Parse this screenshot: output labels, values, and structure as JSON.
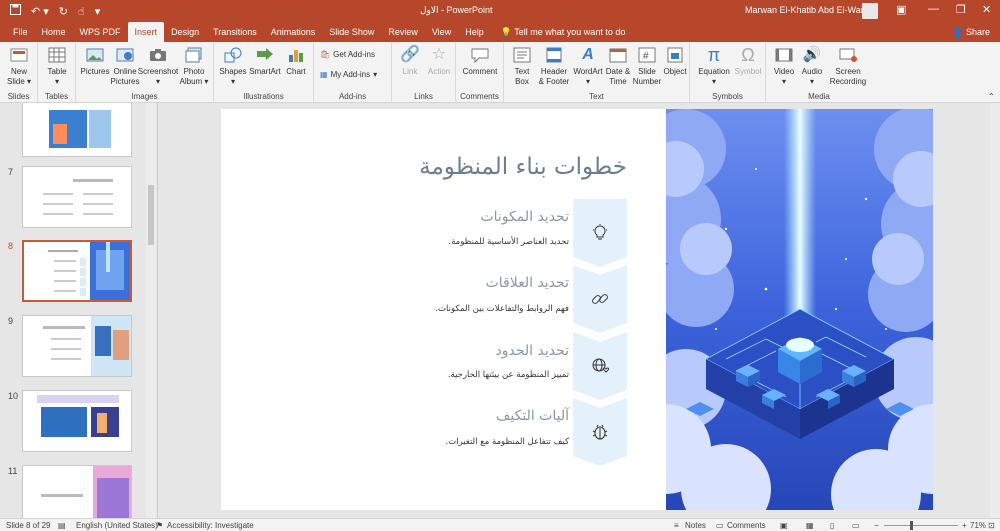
{
  "titlebar": {
    "title": "الاول  -  PowerPoint",
    "user": "Marwan El-Khatib Abd El-Wares",
    "colors": {
      "brand": "#b7472a"
    }
  },
  "menu": {
    "tabs": [
      "File",
      "Home",
      "WPS PDF",
      "Insert",
      "Design",
      "Transitions",
      "Animations",
      "Slide Show",
      "Review",
      "View",
      "Help"
    ],
    "active": "Insert",
    "tell_me": "Tell me what you want to do",
    "share": "Share"
  },
  "ribbon": {
    "groups": {
      "slides": "Slides",
      "tables": "Tables",
      "images": "Images",
      "illustrations": "Illustrations",
      "addins": "Add-ins",
      "links": "Links",
      "comments": "Comments",
      "text": "Text",
      "symbols": "Symbols",
      "media": "Media"
    },
    "buttons": {
      "new_slide": "New\nSlide ▾",
      "table": "Table\n▾",
      "pictures": "Pictures",
      "online_pictures": "Online\nPictures",
      "screenshot": "Screenshot\n▾",
      "photo_album": "Photo\nAlbum ▾",
      "shapes": "Shapes\n▾",
      "smartart": "SmartArt",
      "chart": "Chart",
      "get_addins": "Get Add-ins",
      "my_addins": "My Add-ins",
      "link": "Link",
      "action": "Action",
      "comment": "Comment",
      "text_box": "Text\nBox",
      "header_footer": "Header\n& Footer",
      "wordart": "WordArt\n▾",
      "date_time": "Date &\nTime",
      "slide_number": "Slide\nNumber",
      "object": "Object",
      "equation": "Equation\n▾",
      "symbol": "Symbol",
      "video": "Video\n▾",
      "audio": "Audio\n▾",
      "screen_recording": "Screen\nRecording"
    }
  },
  "thumbnails": [
    {
      "num": "7"
    },
    {
      "num": "8"
    },
    {
      "num": "9"
    },
    {
      "num": "10"
    },
    {
      "num": "11"
    }
  ],
  "slide": {
    "title": "خطوات بناء المنظومة",
    "steps": [
      {
        "title": "تحديد المكونات",
        "desc": "تحديد العناصر الأساسية للمنظومة.",
        "icon": "lightbulb-icon"
      },
      {
        "title": "تحديد العلاقات",
        "desc": "فهم الروابط والتفاعلات بين المكونات.",
        "icon": "link-icon"
      },
      {
        "title": "تحديد الحدود",
        "desc": "تمييز المنظومة عن بيئتها الخارجية.",
        "icon": "globe-heart-icon"
      },
      {
        "title": "آليات التكيف",
        "desc": "كيف تتفاعل المنظومة مع التغيرات.",
        "icon": "bug-icon"
      }
    ],
    "colors": {
      "chevron": "#e4f1fb",
      "title": "#6b7d90"
    }
  },
  "status": {
    "slide_of": "Slide 8 of 29",
    "language": "English (United States)",
    "accessibility": "Accessibility: Investigate",
    "notes": "Notes",
    "comments": "Comments",
    "zoom": "71%"
  }
}
